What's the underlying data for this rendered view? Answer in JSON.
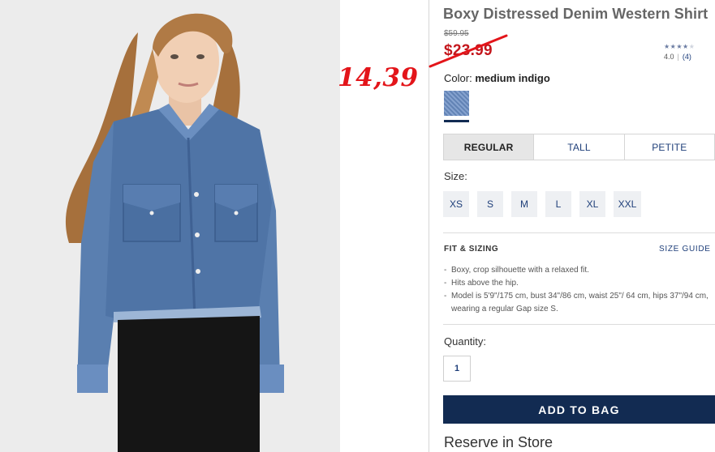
{
  "product": {
    "title": "Boxy Distressed Denim Western Shirt",
    "original_price": "$59.95",
    "sale_price": "$23.99",
    "handwritten_price": "14,39"
  },
  "rating": {
    "stars": "★★★★",
    "stars_empty": "★",
    "value": "4.0",
    "count": "(4)",
    "star_color": "#6b7ca2"
  },
  "color": {
    "label": "Color:",
    "value": "medium indigo",
    "swatch_hex": "#6a8ec4"
  },
  "fit_tabs": [
    {
      "label": "REGULAR",
      "selected": true
    },
    {
      "label": "TALL",
      "selected": false
    },
    {
      "label": "PETITE",
      "selected": false
    }
  ],
  "size": {
    "label": "Size:",
    "options": [
      "XS",
      "S",
      "M",
      "L",
      "XL",
      "XXL"
    ]
  },
  "fit_sizing": {
    "heading": "FIT & SIZING",
    "guide_link": "SIZE GUIDE",
    "bullets": [
      "Boxy, crop silhouette with a relaxed fit.",
      "Hits above the hip.",
      "Model is 5'9\"/175 cm, bust 34\"/86 cm, waist 25\"/ 64 cm, hips 37\"/94 cm, wearing a regular Gap size S."
    ]
  },
  "quantity": {
    "label": "Quantity:",
    "value": "1"
  },
  "actions": {
    "add_to_bag": "ADD TO BAG",
    "reserve": "Reserve in Store"
  },
  "colors": {
    "brand_navy": "#122b52",
    "sale_red": "#c4161c",
    "link_blue": "#1f3f7a"
  }
}
